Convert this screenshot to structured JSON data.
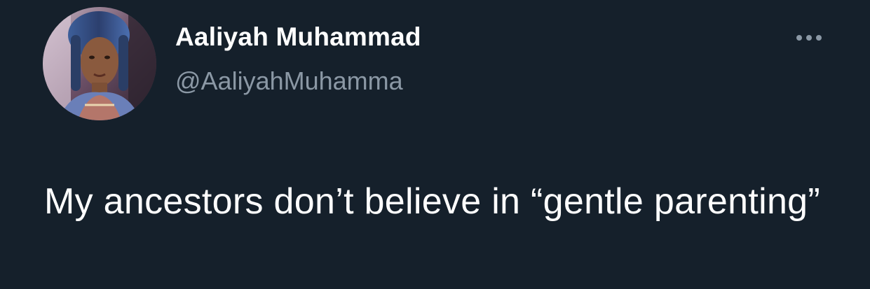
{
  "author": {
    "display_name": "Aaliyah Muhammad",
    "handle": "@AaliyahMuhamma",
    "avatar_icon": "profile-photo"
  },
  "tweet": {
    "text": "My ancestors don’t believe in “gentle parenting”"
  },
  "actions": {
    "more_icon": "more-horizontal-icon"
  },
  "colors": {
    "background": "#15202b",
    "primary_text": "#ffffff",
    "secondary_text": "#8b98a5"
  }
}
